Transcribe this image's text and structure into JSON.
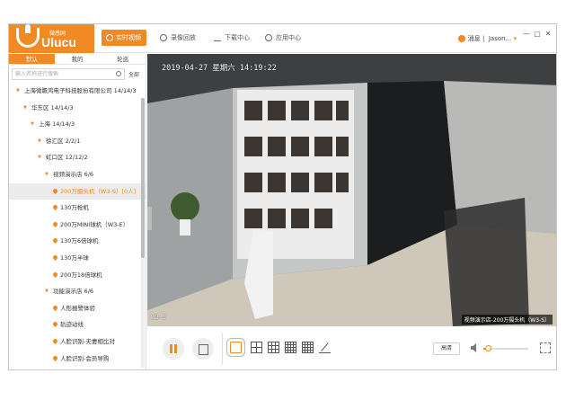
{
  "header": {
    "logo_cn": "微感网",
    "logo_en": "Ulucu",
    "nav": [
      "实时视频",
      "录像回放",
      "下载中心",
      "应用中心"
    ],
    "message": "消息",
    "user": "Jason...",
    "window_controls": [
      "minimize-icon",
      "maximize-icon",
      "close-icon"
    ]
  },
  "sidebar": {
    "tabs": [
      "默认",
      "我的",
      "轮巡"
    ],
    "search_placeholder": "输入名称进行搜索",
    "all_label": "全部",
    "tree": [
      {
        "label": "上海微瞻鸿电子科技股份有限公司  14/14/3",
        "level": 0,
        "type": "group"
      },
      {
        "label": "华东区  14/14/3",
        "level": 1,
        "type": "group"
      },
      {
        "label": "上海  14/14/3",
        "level": 2,
        "type": "group"
      },
      {
        "label": "徐汇区  2/2/1",
        "level": 3,
        "type": "group"
      },
      {
        "label": "虹口区  12/12/2",
        "level": 3,
        "type": "group"
      },
      {
        "label": "视频演示店  6/6",
        "level": 4,
        "type": "group"
      },
      {
        "label": "200万摄头机（W3-S）[0人]",
        "level": 5,
        "type": "camera",
        "selected": true
      },
      {
        "label": "130万枪机",
        "level": 5,
        "type": "camera"
      },
      {
        "label": "200万MINI球机（W3-E）",
        "level": 5,
        "type": "camera"
      },
      {
        "label": "130万6倍球机",
        "level": 5,
        "type": "camera"
      },
      {
        "label": "130万半球",
        "level": 5,
        "type": "camera"
      },
      {
        "label": "200万18倍球机",
        "level": 5,
        "type": "camera"
      },
      {
        "label": "功能演示店  6/6",
        "level": 4,
        "type": "group"
      },
      {
        "label": "人形报警体验",
        "level": 5,
        "type": "camera"
      },
      {
        "label": "轨迹动线",
        "level": 5,
        "type": "camera"
      },
      {
        "label": "人脸识别-夫妻相比对",
        "level": 5,
        "type": "camera"
      },
      {
        "label": "人脸识别-会员导购",
        "level": 5,
        "type": "camera"
      }
    ]
  },
  "video": {
    "timestamp": "2019-04-27 星期六 14:19:22",
    "camera_osd": "W3-S",
    "label": "视频演示店-200万摄头机（W3-S）"
  },
  "controls": {
    "layouts": [
      "1x1",
      "2x2",
      "3x3",
      "4x4",
      "custom"
    ],
    "quality": "高清",
    "volume_fraction": 0.1,
    "accent": "#f08a24"
  }
}
